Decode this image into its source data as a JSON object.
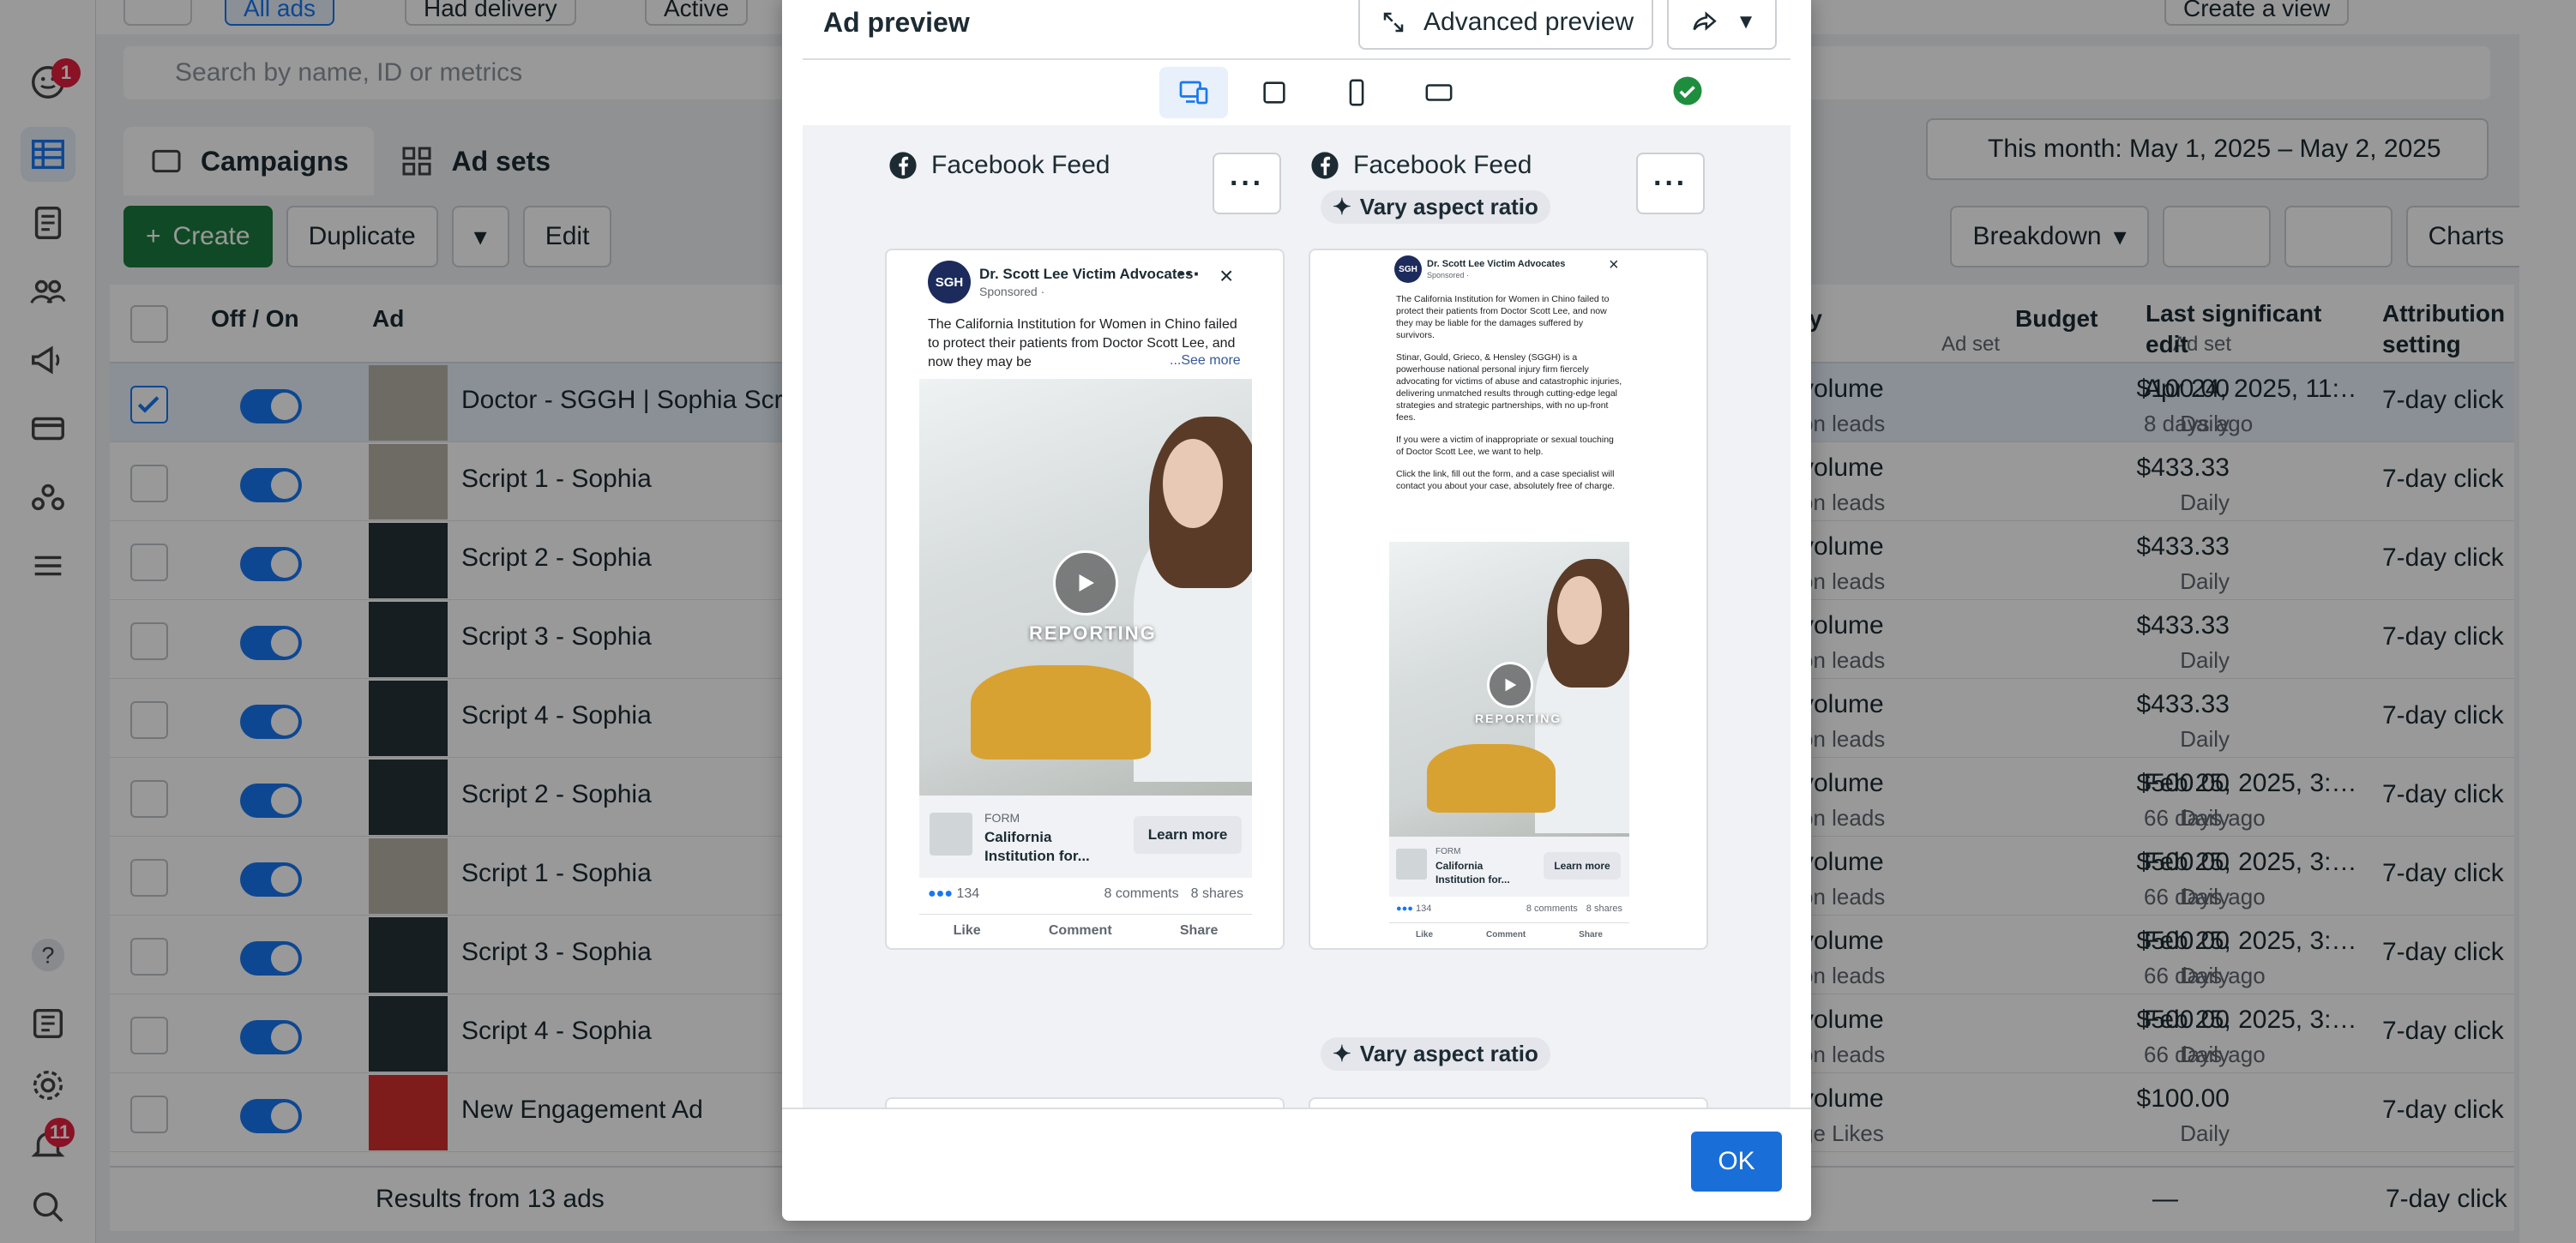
{
  "rail": {
    "notif_count_top": "1",
    "notif_count_bottom": "11"
  },
  "topbar": {
    "all_ads": "All ads",
    "had_delivery": "Had delivery",
    "active": "Active",
    "create_view": "Create a view"
  },
  "search": {
    "placeholder": "Search by name, ID or metrics"
  },
  "tabs": {
    "campaigns": "Campaigns",
    "adsets": "Ad sets"
  },
  "daterange": {
    "label": "This month: May 1, 2025 – May 2, 2025"
  },
  "toolbar": {
    "create": "Create",
    "duplicate": "Duplicate",
    "edit": "Edit",
    "breakdown": "Breakdown",
    "charts": "Charts"
  },
  "table": {
    "headers": {
      "offon": "Off / On",
      "ad": "Ad",
      "delivery": "ty",
      "delivery_sub": "Ad set",
      "budget": "Budget",
      "budget_sub": "Ad set",
      "last_edit": "Last significant edit",
      "attribution": "Attribution setting"
    },
    "rows": [
      {
        "name": "Doctor - SGGH | Sophia Scrip",
        "vol": "volume",
        "vol_sub": "on leads",
        "budget": "$100.00",
        "budget_sub": "Daily",
        "edit": "Apr 24, 2025, 11:…",
        "edit_sub": "8 days ago",
        "attr": "7-day click",
        "thumb": "light",
        "selected": true
      },
      {
        "name": "Script 1 - Sophia",
        "vol": "volume",
        "vol_sub": "on leads",
        "budget": "$433.33",
        "budget_sub": "Daily",
        "edit": "",
        "edit_sub": "",
        "attr": "7-day click",
        "thumb": "light"
      },
      {
        "name": "Script 2 - Sophia",
        "vol": "volume",
        "vol_sub": "on leads",
        "budget": "$433.33",
        "budget_sub": "Daily",
        "edit": "",
        "edit_sub": "",
        "attr": "7-day click",
        "thumb": "dark"
      },
      {
        "name": "Script 3 - Sophia",
        "vol": "volume",
        "vol_sub": "on leads",
        "budget": "$433.33",
        "budget_sub": "Daily",
        "edit": "",
        "edit_sub": "",
        "attr": "7-day click",
        "thumb": "dark"
      },
      {
        "name": "Script 4 - Sophia",
        "vol": "volume",
        "vol_sub": "on leads",
        "budget": "$433.33",
        "budget_sub": "Daily",
        "edit": "",
        "edit_sub": "",
        "attr": "7-day click",
        "thumb": "dark"
      },
      {
        "name": "Script 2 - Sophia",
        "vol": "volume",
        "vol_sub": "on leads",
        "budget": "$500.00",
        "budget_sub": "Daily",
        "edit": "Feb 25, 2025, 3:…",
        "edit_sub": "66 days ago",
        "attr": "7-day click",
        "thumb": "dark"
      },
      {
        "name": "Script 1 - Sophia",
        "vol": "volume",
        "vol_sub": "on leads",
        "budget": "$500.00",
        "budget_sub": "Daily",
        "edit": "Feb 25, 2025, 3:…",
        "edit_sub": "66 days ago",
        "attr": "7-day click",
        "thumb": "light"
      },
      {
        "name": "Script 3 - Sophia",
        "vol": "volume",
        "vol_sub": "on leads",
        "budget": "$500.00",
        "budget_sub": "Daily",
        "edit": "Feb 25, 2025, 3:…",
        "edit_sub": "66 days ago",
        "attr": "7-day click",
        "thumb": "dark"
      },
      {
        "name": "Script 4 - Sophia",
        "vol": "volume",
        "vol_sub": "on leads",
        "budget": "$500.00",
        "budget_sub": "Daily",
        "edit": "Feb 25, 2025, 3:…",
        "edit_sub": "66 days ago",
        "attr": "7-day click",
        "thumb": "dark"
      },
      {
        "name": "New Engagement Ad",
        "vol": "volume",
        "vol_sub": "ge Likes",
        "budget": "$100.00",
        "budget_sub": "Daily",
        "edit": "",
        "edit_sub": "",
        "attr": "7-day click",
        "thumb": "red"
      }
    ],
    "footer": {
      "results": "Results from 13 ads",
      "dash": "—",
      "attr": "7-day click"
    }
  },
  "modal": {
    "title": "Ad preview",
    "advanced": "Advanced preview",
    "ok": "OK",
    "left": {
      "placement": "Facebook Feed"
    },
    "right": {
      "placement": "Facebook Feed",
      "vary": "Vary aspect ratio"
    },
    "vary_lower": "Vary aspect ratio",
    "post": {
      "page": "Dr. Scott Lee Victim Advocates",
      "sponsored": "Sponsored · ",
      "avatar": "SGH",
      "text_short": "The California Institution for Women in Chino failed to protect their patients from Doctor Scott Lee, and now they may be",
      "see_more": "...See more",
      "text_p1": "The California Institution for Women in Chino failed to protect their patients from Doctor Scott Lee, and now they may be liable for the damages suffered by survivors.",
      "text_p2": "Stinar, Gould, Grieco, & Hensley (SGGH) is a powerhouse national personal injury firm fiercely advocating for victims of abuse and catastrophic injuries, delivering unmatched results through cutting-edge legal strategies and strategic partnerships, with no up-front fees.",
      "text_p3": "If you were a victim of inappropriate or sexual touching of Doctor Scott Lee, we want to help.",
      "text_p4": "Click the link, fill out the form, and a case specialist will contact you about your case, absolutely free of charge.",
      "overlay": "REPORTING",
      "form_label": "FORM",
      "form_title": "California Institution for...",
      "cta": "Learn more",
      "reactions": "134",
      "comments": "8 comments",
      "shares": "8 shares",
      "like": "Like",
      "comment": "Comment",
      "share": "Share"
    }
  },
  "colors": {
    "primary": "#1877f2",
    "create_green": "#1b7a3e",
    "ok_blue": "#1a6ed8",
    "badge_red": "#e41e3f",
    "check_green": "#1e8e3e"
  }
}
